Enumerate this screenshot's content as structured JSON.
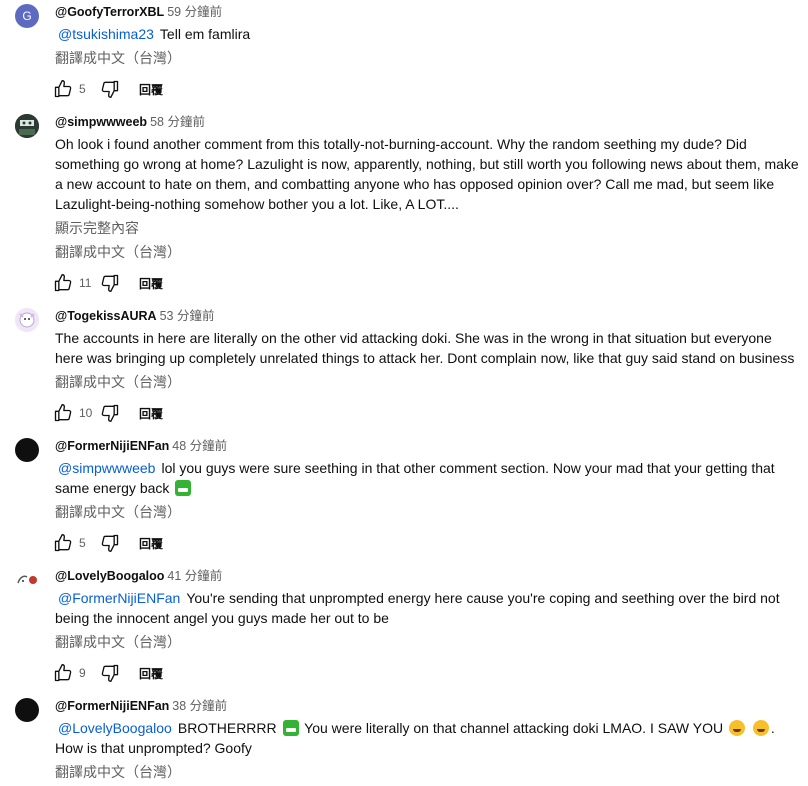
{
  "translate_label": "翻譯成中文（台灣）",
  "reply_label": "回覆",
  "comments": [
    {
      "avatar_letter": "G",
      "author": "@GoofyTerrorXBL",
      "time": "59 分鐘前",
      "mention": "@tsukishima23",
      "text": "Tell em famlira",
      "likes": "5"
    },
    {
      "author": "@simpwwweeb",
      "time": "58 分鐘前",
      "text": "Oh look i found another comment from this totally-not-burning-account. Why the random seething my dude? Did something go wrong at home? Lazulight is now, apparently, nothing, but still worth you following news about them, make a new account to hate on them, and combatting anyone who has opposed opinion over?  Call me mad, but seem like Lazulight-being-nothing somehow bother you a lot. Like, A LOT....",
      "show_more": "顯示完整內容",
      "likes": "11"
    },
    {
      "author": "@TogekissAURA",
      "time": "53 分鐘前",
      "text": "The accounts in here are literally on the other vid attacking doki. She was in the wrong in that situation but everyone here was bringing up completely unrelated things to attack her. Dont complain now, like that guy said stand on business",
      "likes": "10"
    },
    {
      "author": "@FormerNijiENFan",
      "time": "48 分鐘前",
      "mention": "@simpwwweeb",
      "text": "lol you guys were sure seething in that other comment section. Now your mad that your getting that same energy back",
      "likes": "5"
    },
    {
      "author": "@LovelyBoogaloo",
      "time": "41 分鐘前",
      "mention": "@FormerNijiENFan",
      "text": "You're sending that unprompted energy here cause you're coping and seething over the bird not being the innocent angel you guys made her out to be",
      "likes": "9"
    },
    {
      "author": "@FormerNijiENFan",
      "time": "38 分鐘前",
      "mention": "@LovelyBoogaloo",
      "text_part1": "BROTHERRRR",
      "text_part2": "You were literally on that channel attacking doki LMAO. I SAW YOU",
      "text_part3": ". How is that unprompted? Goofy"
    }
  ]
}
